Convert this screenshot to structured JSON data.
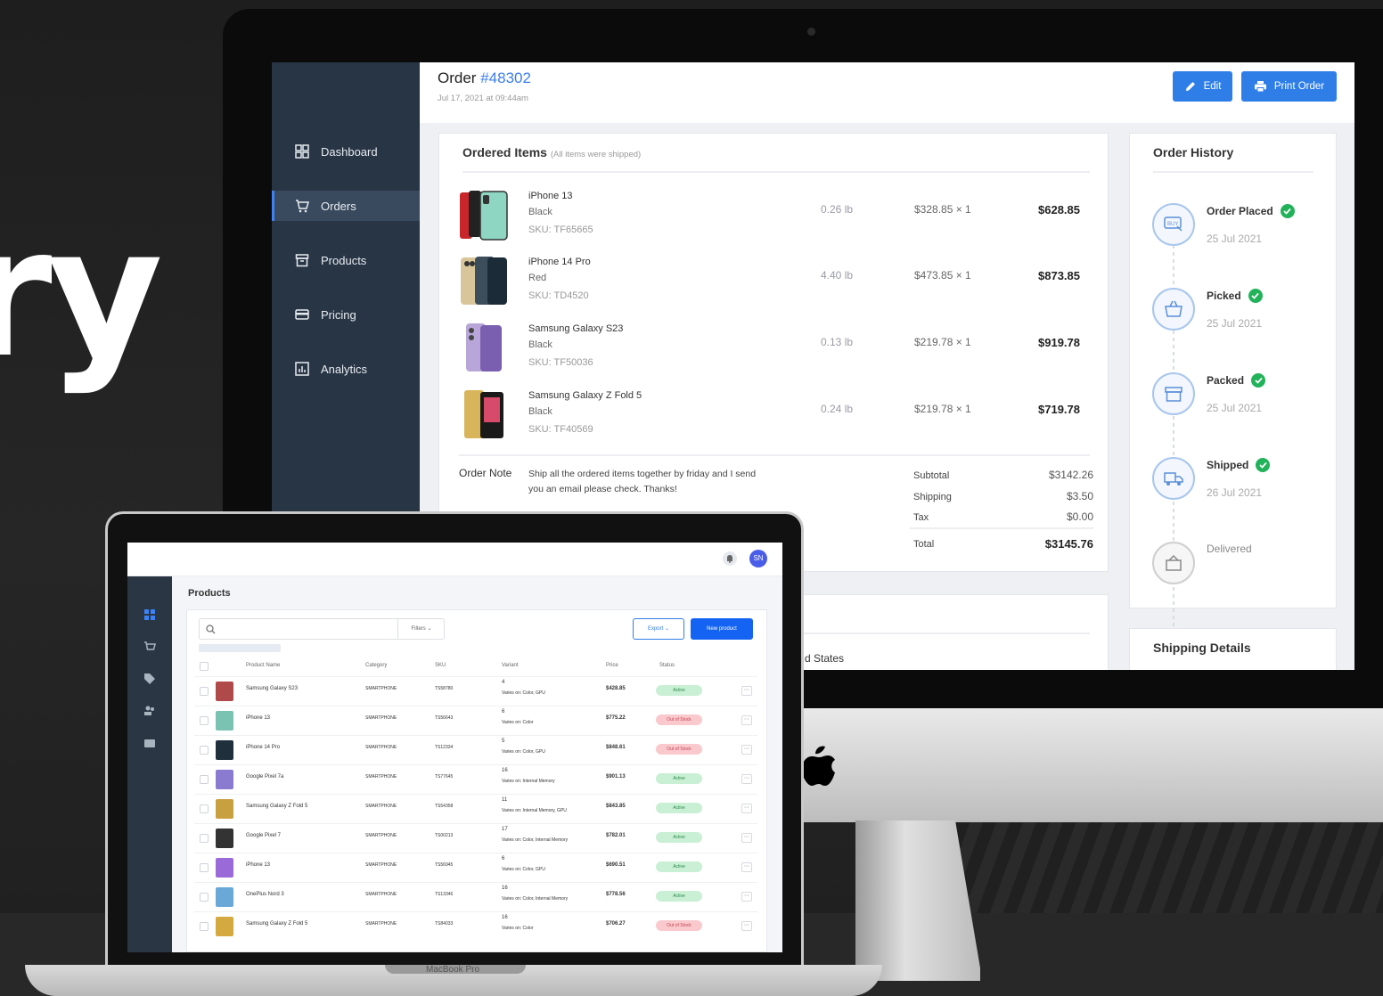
{
  "hero": {
    "text": "ry"
  },
  "imac": {
    "sidebar": {
      "items": [
        {
          "label": "Dashboard",
          "icon": "dashboard-icon",
          "active": false
        },
        {
          "label": "Orders",
          "icon": "cart-icon",
          "active": true
        },
        {
          "label": "Products",
          "icon": "box-icon",
          "active": false
        },
        {
          "label": "Pricing",
          "icon": "card-icon",
          "active": false
        },
        {
          "label": "Analytics",
          "icon": "chart-icon",
          "active": false
        }
      ]
    },
    "header": {
      "title_prefix": "Order",
      "order_number": "#48302",
      "date": "Jul 17, 2021 at 09:44am",
      "edit_label": "Edit",
      "print_label": "Print Order"
    },
    "ordered_items": {
      "title": "Ordered Items",
      "subtitle": "(All items were shipped)",
      "items": [
        {
          "name": "iPhone 13",
          "color": "Black",
          "sku": "SKU: TF65665",
          "weight": "0.26 lb",
          "price": "$328.85 × 1",
          "total": "$628.85"
        },
        {
          "name": "iPhone 14 Pro",
          "color": "Red",
          "sku": "SKU: TD4520",
          "weight": "4.40 lb",
          "price": "$473.85 × 1",
          "total": "$873.85"
        },
        {
          "name": "Samsung Galaxy S23",
          "color": "Black",
          "sku": "SKU: TF50036",
          "weight": "0.13 lb",
          "price": "$219.78 × 1",
          "total": "$919.78"
        },
        {
          "name": "Samsung Galaxy Z Fold 5",
          "color": "Black",
          "sku": "SKU: TF40569",
          "weight": "0.24 lb",
          "price": "$219.78 × 1",
          "total": "$719.78"
        }
      ],
      "note_label": "Order Note",
      "note_text": "Ship all the ordered items together by friday and I send you an email please check. Thanks!",
      "summary": {
        "subtotal_label": "Subtotal",
        "subtotal": "$3142.26",
        "shipping_label": "Shipping",
        "shipping": "$3.50",
        "tax_label": "Tax",
        "tax": "$0.00",
        "total_label": "Total",
        "total": "$3145.76"
      },
      "partial_text": "d States"
    },
    "order_history": {
      "title": "Order History",
      "steps": [
        {
          "label": "Order Placed",
          "date": "25 Jul 2021",
          "done": true,
          "icon": "buy-icon"
        },
        {
          "label": "Picked",
          "date": "25 Jul 2021",
          "done": true,
          "icon": "basket-icon"
        },
        {
          "label": "Packed",
          "date": "25 Jul 2021",
          "done": true,
          "icon": "package-icon"
        },
        {
          "label": "Shipped",
          "date": "26 Jul 2021",
          "done": true,
          "icon": "truck-icon"
        },
        {
          "label": "Delivered",
          "date": "",
          "done": false,
          "icon": "delivered-icon"
        }
      ]
    },
    "shipping_details": {
      "title": "Shipping Details"
    }
  },
  "macbook": {
    "label": "MacBook Pro",
    "avatar": "SN",
    "page_title": "Products",
    "filters_label": "Filters",
    "export_label": "Export",
    "new_product_label": "New product",
    "headers": [
      "Product Name",
      "Category",
      "SKU",
      "Variant",
      "Price",
      "Status"
    ],
    "rows": [
      {
        "name": "Samsung Galaxy S23",
        "category": "SMARTPHONE",
        "sku": "TS58780",
        "variant_count": "4",
        "variant": "Varies on: Color, GPU",
        "price": "$428.85",
        "status": "Active"
      },
      {
        "name": "iPhone 13",
        "category": "SMARTPHONE",
        "sku": "TS56643",
        "variant_count": "6",
        "variant": "Varies on: Color",
        "price": "$775.22",
        "status": "Out of Stock"
      },
      {
        "name": "iPhone 14 Pro",
        "category": "SMARTPHONE",
        "sku": "TS12334",
        "variant_count": "5",
        "variant": "Varies on: Color, GPU",
        "price": "$848.61",
        "status": "Out of Stock"
      },
      {
        "name": "Google Pixel 7a",
        "category": "SMARTPHONE",
        "sku": "TS77645",
        "variant_count": "16",
        "variant": "Varies on: Internal Memory",
        "price": "$901.13",
        "status": "Active"
      },
      {
        "name": "Samsung Galaxy Z Fold 5",
        "category": "SMARTPHONE",
        "sku": "TS54358",
        "variant_count": "11",
        "variant": "Varies on: Internal Memory, GPU",
        "price": "$843.85",
        "status": "Active"
      },
      {
        "name": "Google Pixel 7",
        "category": "SMARTPHONE",
        "sku": "TS00213",
        "variant_count": "17",
        "variant": "Varies on: Color, Internal Memory",
        "price": "$782.01",
        "status": "Active"
      },
      {
        "name": "iPhone 13",
        "category": "SMARTPHONE",
        "sku": "TS56945",
        "variant_count": "6",
        "variant": "Varies on: Color, GPU",
        "price": "$690.51",
        "status": "Active"
      },
      {
        "name": "OnePlus Nord 3",
        "category": "SMARTPHONE",
        "sku": "TS13346",
        "variant_count": "16",
        "variant": "Varies on: Color, Internal Memory",
        "price": "$778.56",
        "status": "Active"
      },
      {
        "name": "Samsung Galaxy Z Fold 5",
        "category": "SMARTPHONE",
        "sku": "TS84033",
        "variant_count": "16",
        "variant": "Varies on: Color",
        "price": "$706.27",
        "status": "Out of Stock"
      }
    ]
  },
  "colors": {
    "accent": "#2f7ee8",
    "sidebar": "#283545",
    "success": "#22b35a"
  }
}
